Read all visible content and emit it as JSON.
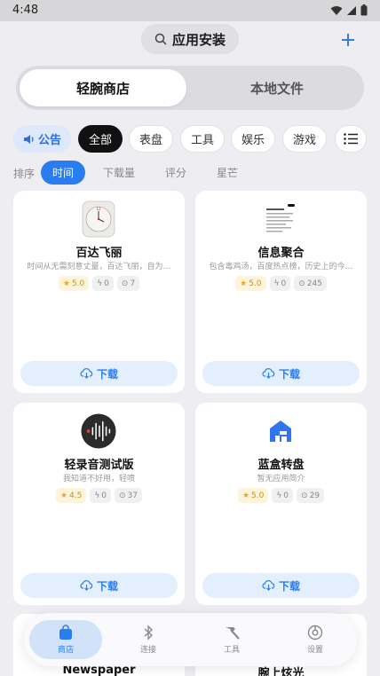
{
  "status_bar": {
    "time": "4:48"
  },
  "header": {
    "title": "应用安装"
  },
  "segment": {
    "tabs": [
      "轻腕商店",
      "本地文件"
    ]
  },
  "chips": {
    "notice": "公告",
    "items": [
      "全部",
      "表盘",
      "工具",
      "娱乐",
      "游戏"
    ]
  },
  "sort": {
    "label": "排序",
    "options": [
      "时间",
      "下载量",
      "评分",
      "星芒"
    ]
  },
  "apps": [
    {
      "name": "百达飞丽",
      "desc": "时间从无需刻意丈量，百达飞丽，自为…",
      "rating": "5.0",
      "likes": "0",
      "downloads": "7",
      "download_label": "下载"
    },
    {
      "name": "信息聚合",
      "desc": "包含毒鸡汤，百度热点榜，历史上的今…",
      "rating": "5.0",
      "likes": "0",
      "downloads": "245",
      "download_label": "下载"
    },
    {
      "name": "轻录音测试版",
      "desc": "我知道不好用，轻喷",
      "rating": "4.5",
      "likes": "0",
      "downloads": "37",
      "download_label": "下载"
    },
    {
      "name": "蓝盒转盘",
      "desc": "暂无应用简介",
      "rating": "5.0",
      "likes": "0",
      "downloads": "29",
      "download_label": "下载"
    },
    {
      "name": "Newspaper"
    },
    {
      "name": "腕上炫光"
    }
  ],
  "nav": {
    "items": [
      "商店",
      "连接",
      "工具",
      "设置"
    ]
  },
  "colors": {
    "accent": "#2a7df0",
    "rating": "#e6a91e"
  }
}
